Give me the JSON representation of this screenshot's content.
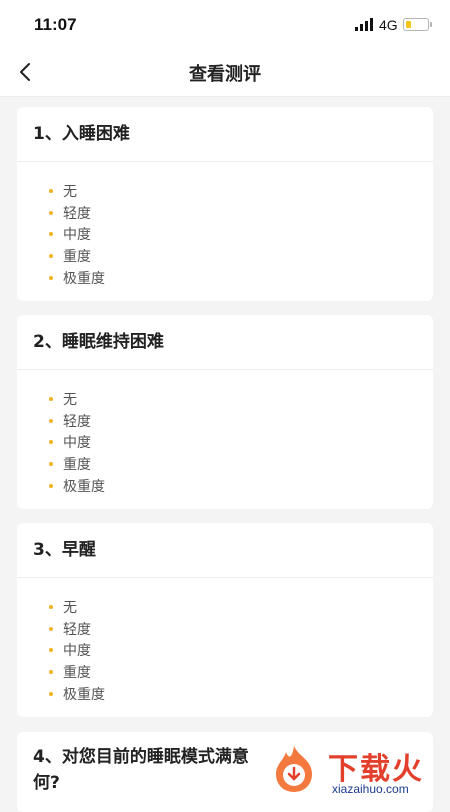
{
  "status_bar": {
    "time": "11:07",
    "network": "4G",
    "battery_level": 0.25
  },
  "header": {
    "title": "查看测评"
  },
  "questions": [
    {
      "title": "1、入睡困难",
      "options": [
        "无",
        "轻度",
        "中度",
        "重度",
        "极重度"
      ]
    },
    {
      "title": "2、睡眠维持困难",
      "options": [
        "无",
        "轻度",
        "中度",
        "重度",
        "极重度"
      ]
    },
    {
      "title": "3、早醒",
      "options": [
        "无",
        "轻度",
        "中度",
        "重度",
        "极重度"
      ]
    },
    {
      "title_line1": "4、对您目前的睡眠模式满意",
      "title_line2": "何?"
    }
  ],
  "watermark": {
    "text": "下载火",
    "url": "xiazaihuo.com"
  },
  "colors": {
    "accent_dot": "#f0b324",
    "battery": "#f5c518",
    "watermark": "#e2402c"
  }
}
